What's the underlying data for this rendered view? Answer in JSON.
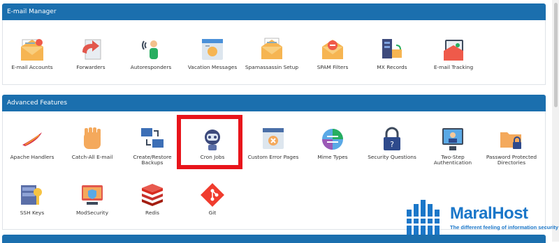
{
  "email_section": {
    "title": "E-mail Manager",
    "items": [
      {
        "label": "E-mail Accounts",
        "icon": "envelope-accounts-icon"
      },
      {
        "label": "Forwarders",
        "icon": "forward-arrow-icon"
      },
      {
        "label": "Autoresponders",
        "icon": "autoresponder-person-icon"
      },
      {
        "label": "Vacation Messages",
        "icon": "vacation-message-icon"
      },
      {
        "label": "Spamassassin Setup",
        "icon": "spamassassin-envelope-icon"
      },
      {
        "label": "SPAM Filters",
        "icon": "spam-filter-envelope-icon"
      },
      {
        "label": "MX Records",
        "icon": "mx-server-icon"
      },
      {
        "label": "E-mail Tracking",
        "icon": "email-tracking-icon"
      }
    ]
  },
  "advanced_section": {
    "title": "Advanced Features",
    "items": [
      {
        "label": "Apache Handlers",
        "icon": "apache-feather-icon"
      },
      {
        "label": "Catch-All E-mail",
        "icon": "catch-all-hand-icon"
      },
      {
        "label": "Create/Restore Backups",
        "icon": "backup-computers-icon"
      },
      {
        "label": "Cron Jobs",
        "icon": "cron-robot-icon"
      },
      {
        "label": "Custom Error Pages",
        "icon": "error-page-icon"
      },
      {
        "label": "Mime Types",
        "icon": "mime-types-icon"
      },
      {
        "label": "Security Questions",
        "icon": "padlock-icon"
      },
      {
        "label": "Two-Step Authentication",
        "icon": "two-step-auth-icon"
      },
      {
        "label": "Password Protected Directories",
        "icon": "protected-folder-icon"
      },
      {
        "label": "SSH Keys",
        "icon": "ssh-key-icon"
      },
      {
        "label": "ModSecurity",
        "icon": "modsecurity-shield-icon"
      },
      {
        "label": "Redis",
        "icon": "redis-icon"
      },
      {
        "label": "Git",
        "icon": "git-icon"
      }
    ]
  },
  "watermark": {
    "brand": "MaralHost",
    "tagline": "The different feeling of information security"
  },
  "colors": {
    "header_blue": "#1b6fae",
    "highlight_red": "#e8141b",
    "brand_blue": "#1b77c9"
  }
}
